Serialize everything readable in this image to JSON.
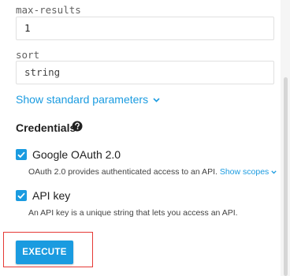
{
  "params": [
    {
      "label": "max-results",
      "value": "1",
      "placeholder": ""
    },
    {
      "label": "sort",
      "value": "",
      "placeholder": "string"
    }
  ],
  "show_standard_params": "Show standard parameters",
  "credentials": {
    "title": "Credentials",
    "items": [
      {
        "label": "Google OAuth 2.0",
        "checked": true,
        "description": "OAuth 2.0 provides authenticated access to an API.",
        "scopes_link": "Show scopes"
      },
      {
        "label": "API key",
        "checked": true,
        "description": "An API key is a unique string that lets you access an API."
      }
    ]
  },
  "execute_label": "EXECUTE",
  "colors": {
    "accent": "#1a9be0",
    "highlight": "#e53935"
  },
  "icons": {
    "help": "help-circle-icon",
    "chevron": "chevron-down-icon",
    "check": "check-icon"
  }
}
